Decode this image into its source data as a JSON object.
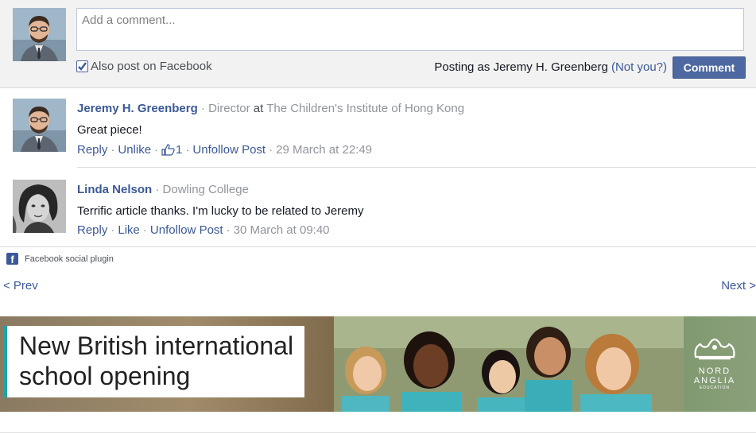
{
  "compose": {
    "placeholder": "Add a comment...",
    "also_post_label": "Also post on Facebook",
    "also_post_checked": true,
    "posting_as_prefix": "Posting as Jeremy H. Greenberg",
    "not_you_label": "(Not you?)",
    "comment_button": "Comment"
  },
  "comments": [
    {
      "name": "Jeremy H. Greenberg",
      "meta_sep": "·",
      "role": "Director",
      "at": "at",
      "org": "The Children's Institute of Hong Kong",
      "text": "Great piece!",
      "actions": {
        "reply": "Reply",
        "like": "Unlike",
        "likes_count": "1",
        "unfollow": "Unfollow Post",
        "timestamp": "29 March at 22:49"
      }
    },
    {
      "name": "Linda Nelson",
      "meta_sep": "·",
      "org": "Dowling College",
      "text": "Terrific article thanks. I'm lucky to be related to Jeremy",
      "actions": {
        "reply": "Reply",
        "like": "Like",
        "unfollow": "Unfollow Post",
        "timestamp": "30 March at 09:40"
      }
    }
  ],
  "plugin": {
    "label": "Facebook social plugin",
    "icon": "facebook-icon"
  },
  "pager": {
    "prev": "< Prev",
    "next": "Next >"
  },
  "banner": {
    "headline_line1": "New British international",
    "headline_line2": "school opening",
    "logo_line1": "NORD",
    "logo_line2": "ANGLIA",
    "logo_line3": "EDUCATION",
    "accent": "#1fa4a6"
  },
  "colors": {
    "link": "#3b5998",
    "button": "#4e69a2",
    "muted": "#90949c"
  }
}
